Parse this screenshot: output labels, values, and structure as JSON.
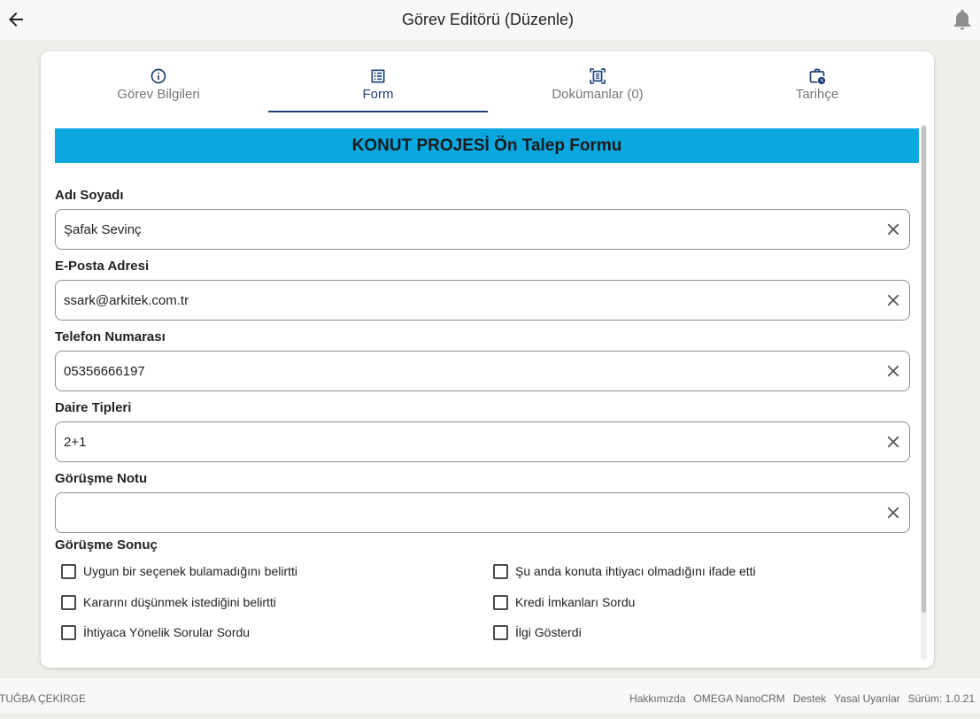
{
  "header": {
    "title": "Görev Editörü (Düzenle)",
    "back_icon": "arrow-left-icon",
    "notification_icon": "bell-icon"
  },
  "tabs": [
    {
      "label": "Görev Bilgileri",
      "icon": "info-icon",
      "active": false
    },
    {
      "label": "Form",
      "icon": "list-icon",
      "active": true
    },
    {
      "label": "Dokümanlar (0)",
      "icon": "document-scan-icon",
      "active": false
    },
    {
      "label": "Tarihçe",
      "icon": "briefcase-clock-icon",
      "active": false
    }
  ],
  "form": {
    "title": "KONUT PROJESİ Ön Talep Formu",
    "fields": [
      {
        "label": "Adı Soyadı",
        "value": "Şafak Sevinç"
      },
      {
        "label": "E-Posta Adresi",
        "value": "ssark@arkitek.com.tr"
      },
      {
        "label": "Telefon Numarası",
        "value": "05356666197"
      },
      {
        "label": "Daire Tipleri",
        "value": "2+1"
      },
      {
        "label": "Görüşme Notu",
        "value": ""
      }
    ],
    "clear_icon": "close-icon",
    "result": {
      "label": "Görüşme Sonuç",
      "options": [
        {
          "label": "Uygun bir seçenek bulamadığını belirtti",
          "checked": false
        },
        {
          "label": "Şu anda konuta ihtiyacı olmadığını ifade etti",
          "checked": false
        },
        {
          "label": "Kararını düşünmek istediğini belirtti",
          "checked": false
        },
        {
          "label": "Kredi İmkanları Sordu",
          "checked": false
        },
        {
          "label": "İhtiyaca Yönelik Sorular Sordu",
          "checked": false
        },
        {
          "label": "İlgi Gösterdi",
          "checked": false
        }
      ]
    }
  },
  "footer": {
    "user": "TUĞBA ÇEKİRGE",
    "links": [
      "Hakkımızda",
      "OMEGA NanoCRM",
      "Destek",
      "Yasal Uyarılar"
    ],
    "version": "Sürüm: 1.0.21"
  },
  "colors": {
    "page_background": "#efeee9",
    "form_title_background": "#0aa7df",
    "primary": "#1d3f73",
    "muted_text": "#777777"
  }
}
